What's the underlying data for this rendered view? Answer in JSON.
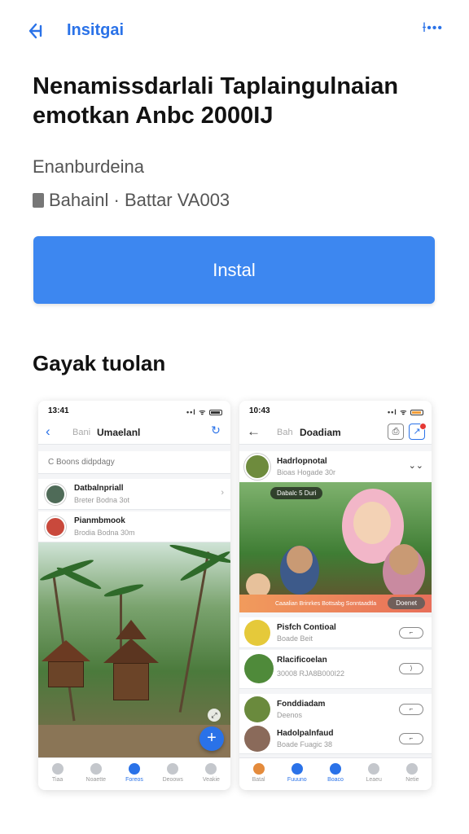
{
  "header": {
    "back_icon": "back-arrow-icon",
    "title": "Insitgai",
    "more_label": "Ɨ•••"
  },
  "app": {
    "title": "Nenamissdarlali Taplaingulnaian emotkan Anbc 2000IJ",
    "developer": "Enanburdeina",
    "meta": "Bahainl · Battar VA003",
    "install_label": "Instal",
    "colors": {
      "accent": "#3d87f0",
      "link": "#2a72e8"
    }
  },
  "screenshots": {
    "heading": "Gayak tuolan",
    "a": {
      "time": "13:41",
      "signal": "••l ᯤ",
      "nav_sub": "Bani",
      "nav_title": "Umaelanl",
      "search": "C Boons didpdagy",
      "chats": [
        {
          "name": "Datbalnpriall",
          "sub": "Breter Bodna 3ot"
        },
        {
          "name": "Pianmbmook",
          "sub": "Brodia Bodna 30m"
        }
      ],
      "fab": "+",
      "tabs": [
        "Tiaa",
        "Noaette",
        "Foreos",
        "Deoows",
        "Veakie"
      ]
    },
    "b": {
      "time": "10:43",
      "signal": "••l ᯤ",
      "nav_sub": "Bah",
      "nav_title": "Doadiam",
      "post": {
        "name": "Hadrlopnotal",
        "sub": "Bioas Hogade 30r"
      },
      "pill": "Dabalc 5 Duri",
      "caption": "Caaalian Brinrkes Bottsabg Sonntaadtla",
      "caption_button": "Doenet",
      "items": [
        {
          "name": "Pisfch Contioal",
          "sub": "Boade Beit"
        },
        {
          "name": "Rlacificoelan",
          "sub": "30008 RJA8B000I22"
        },
        {
          "name": "Fonddiadam",
          "sub": "Deenos"
        },
        {
          "name": "Hadolpalnfaud",
          "sub": "Boade Fuagic 38"
        }
      ],
      "tabs": [
        "Batal",
        "Fuuuno",
        "Boaco",
        "Leaeu",
        "Netie"
      ]
    }
  }
}
